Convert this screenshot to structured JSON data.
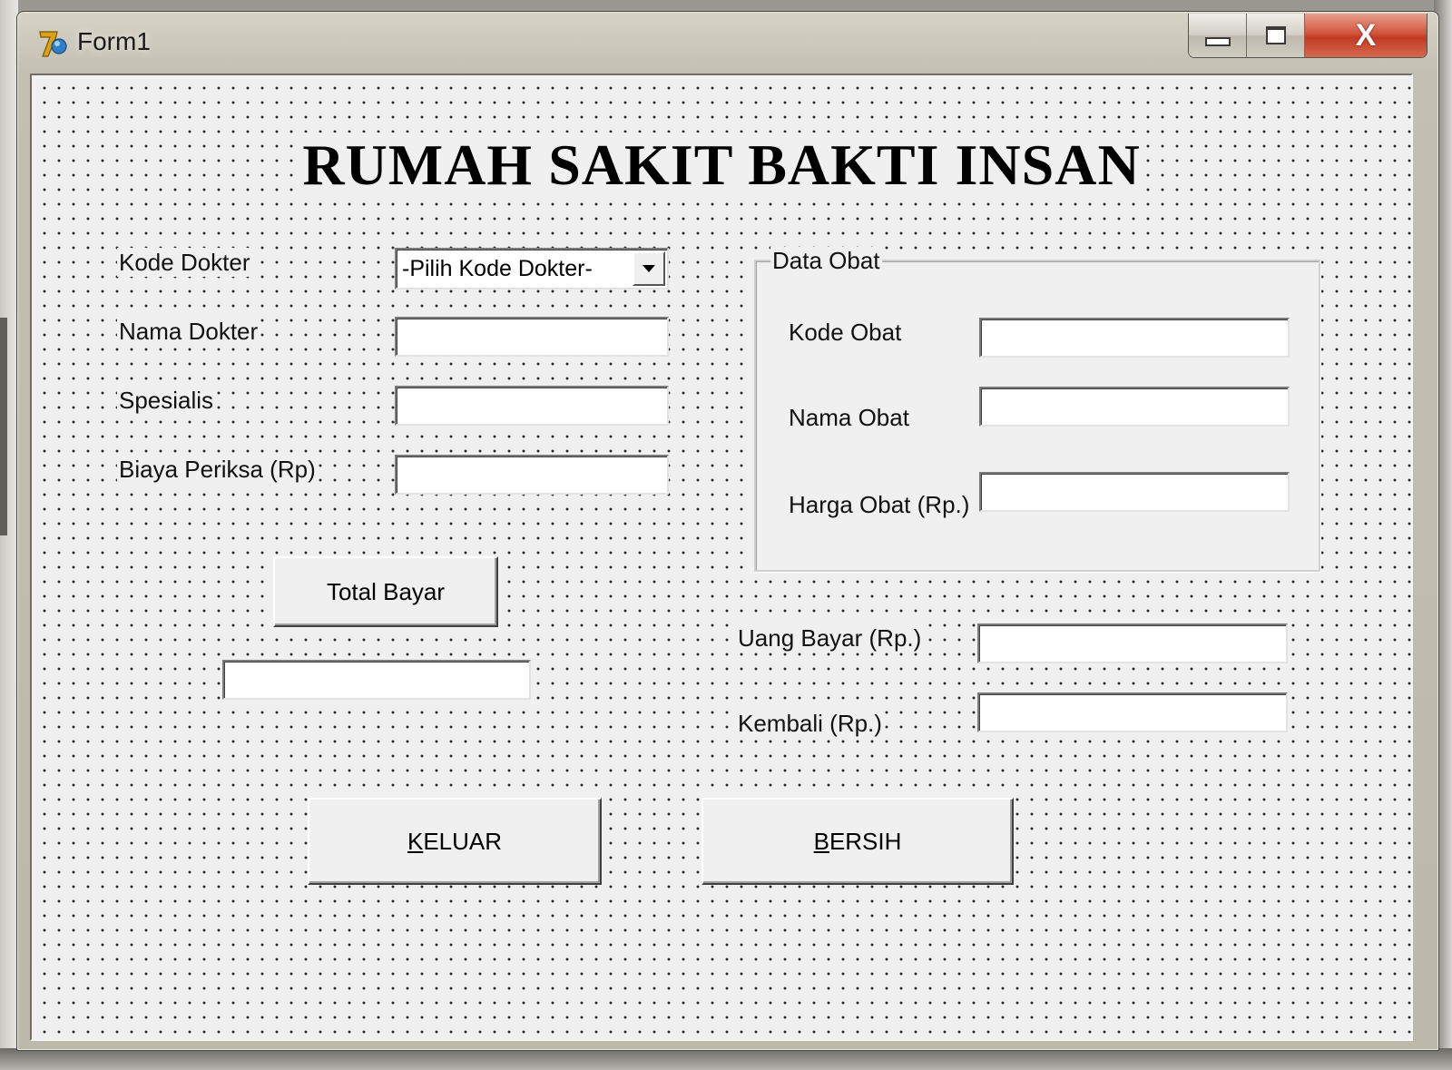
{
  "window": {
    "title": "Form1",
    "minimize_glyph": "minimize-icon",
    "maximize_glyph": "maximize-icon",
    "close_symbol": "X"
  },
  "form": {
    "heading": "RUMAH SAKIT BAKTI INSAN",
    "kode_dokter": {
      "label": "Kode Dokter",
      "selected": "-Pilih Kode Dokter-"
    },
    "nama_dokter": {
      "label": "Nama Dokter",
      "value": ""
    },
    "spesialis": {
      "label": "Spesialis",
      "value": ""
    },
    "biaya_periksa": {
      "label": "Biaya Periksa (Rp)",
      "value": ""
    },
    "total_bayar_button": "Total Bayar",
    "total_bayar_value": "",
    "data_obat": {
      "caption": "Data Obat",
      "kode_obat": {
        "label": "Kode Obat",
        "value": ""
      },
      "nama_obat": {
        "label": "Nama Obat",
        "value": ""
      },
      "harga_obat": {
        "label": "Harga Obat (Rp.)",
        "value": ""
      }
    },
    "uang_bayar": {
      "label": "Uang Bayar (Rp.)",
      "value": ""
    },
    "kembali": {
      "label": "Kembali (Rp.)",
      "value": ""
    },
    "keluar_button": {
      "accel": "K",
      "rest": "ELUAR"
    },
    "bersih_button": {
      "accel": "B",
      "rest": "ERSIH"
    }
  },
  "colors": {
    "client_bg": "#f0f0f0",
    "close_button": "#c23b22",
    "title_bar": "#c3bfb1"
  }
}
